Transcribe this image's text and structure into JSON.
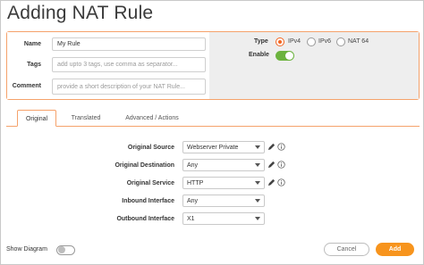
{
  "dialog": {
    "title": "Adding NAT Rule"
  },
  "general": {
    "name_label": "Name",
    "name_value": "My Rule",
    "tags_label": "Tags",
    "tags_placeholder": "add upto 3 tags, use comma as separator...",
    "comment_label": "Comment",
    "comment_placeholder": "provide a short description of your NAT Rule..."
  },
  "type": {
    "label": "Type",
    "options": [
      "IPv4",
      "IPv6",
      "NAT 64"
    ],
    "selected": "IPv4"
  },
  "enable": {
    "label": "Enable",
    "on": true
  },
  "tabs": [
    "Original",
    "Translated",
    "Advanced / Actions"
  ],
  "active_tab": "Original",
  "rows": [
    {
      "label": "Original Source",
      "value": "Webserver Private",
      "edit": true,
      "info": true
    },
    {
      "label": "Original Destination",
      "value": "Any",
      "edit": true,
      "info": true
    },
    {
      "label": "Original Service",
      "value": "HTTP",
      "edit": true,
      "info": true
    },
    {
      "label": "Inbound Interface",
      "value": "Any",
      "edit": false,
      "info": false
    },
    {
      "label": "Outbound Interface",
      "value": "X1",
      "edit": false,
      "info": false
    }
  ],
  "footer": {
    "show_diagram_label": "Show Diagram",
    "show_diagram_on": false,
    "cancel_label": "Cancel",
    "add_label": "Add"
  },
  "colors": {
    "accent": "#f26522",
    "add_button": "#f7941d",
    "toggle_on": "#6cb33e",
    "panel_border": "#f5a26b"
  },
  "icons": {
    "edit": "pencil-icon",
    "info": "info-icon",
    "dropdown": "chevron-down-icon"
  }
}
